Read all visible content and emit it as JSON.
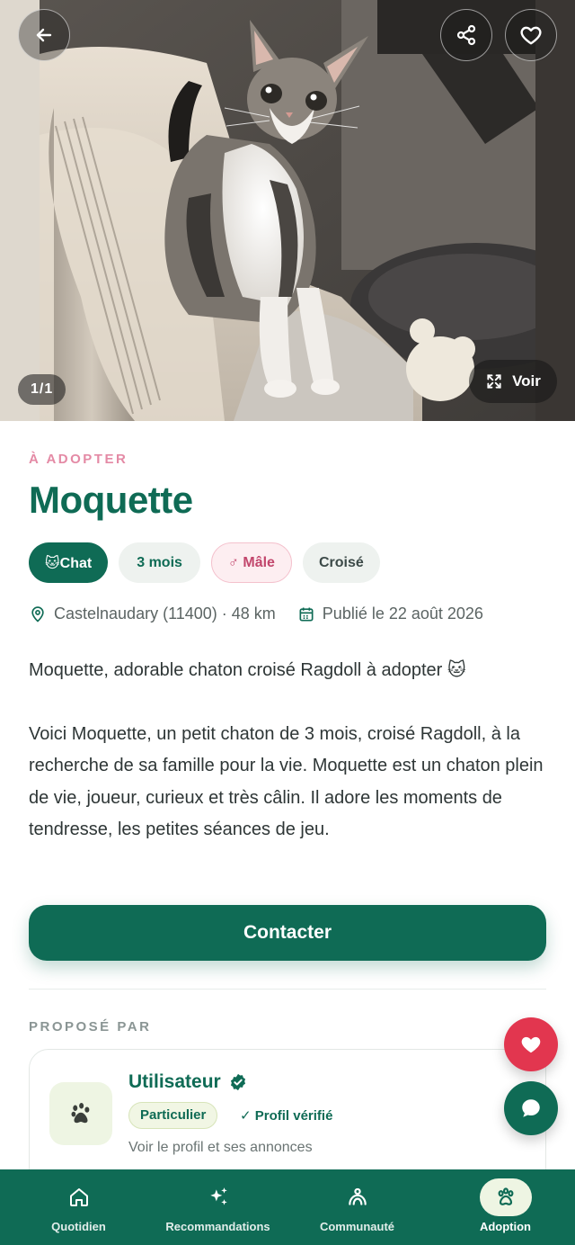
{
  "listing": {
    "photo_counter": "1/1",
    "view_label": "Voir",
    "status": "À ADOPTER",
    "name": "Moquette",
    "chips": {
      "type": "🐱Chat",
      "age": "3 mois",
      "sex": "♂ Mâle",
      "breed": "Croisé"
    },
    "location": "Castelnaudary (11400) · 48 km",
    "published": "Publié le 22 août 2026",
    "description_title": "Moquette, adorable chaton croisé Ragdoll à adopter 🐱",
    "description_body": "Voici Moquette, un petit chaton de 3 mois, croisé Ragdoll, à la recherche de sa famille pour la vie. Moquette est un chaton plein de vie, joueur, curieux et très câlin. Il adore les moments de tendresse, les petites séances de jeu."
  },
  "actions": {
    "contact_label": "Contacter"
  },
  "owner": {
    "section_label": "PROPOSÉ PAR",
    "name": "Utilisateur",
    "tag": "Particulier",
    "verified": "✓ Profil vérifié",
    "link": "Voir le profil et ses annonces"
  },
  "icons": {
    "back": "arrow-left-icon",
    "share": "share-icon",
    "favorite": "heart-outline-icon",
    "expand": "expand-icon",
    "location": "map-pin-icon",
    "calendar": "calendar-icon",
    "verified": "verified-badge-icon",
    "paw": "paw-icon",
    "chat": "chat-bubble-icon"
  },
  "nav": {
    "items": [
      {
        "label": "Quotidien",
        "icon": "home-icon"
      },
      {
        "label": "Recommandations",
        "icon": "sparkles-icon"
      },
      {
        "label": "Communauté",
        "icon": "community-icon"
      },
      {
        "label": "Adoption",
        "icon": "paw-icon",
        "active": true
      }
    ]
  },
  "colors": {
    "primary": "#0f6b55",
    "accent_pink": "#e48aa5",
    "favorite_red": "#e2364f",
    "light_green": "#eef5e3"
  }
}
